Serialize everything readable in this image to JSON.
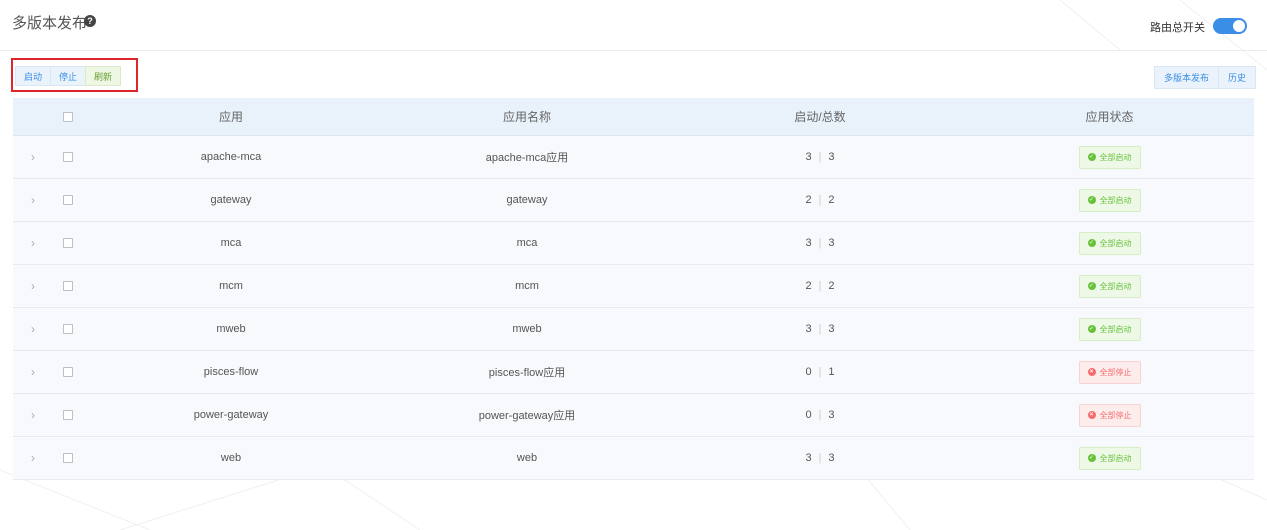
{
  "header": {
    "title": "多版本发布",
    "help_icon": "question-circle-icon",
    "route_switch_label": "路由总开关",
    "route_switch_on": true
  },
  "toolbar": {
    "start_label": "启动",
    "stop_label": "停止",
    "refresh_label": "刷新",
    "multi_release_label": "多版本发布",
    "history_label": "历史"
  },
  "table": {
    "columns": {
      "app": "应用",
      "name": "应用名称",
      "count": "启动/总数",
      "status": "应用状态"
    },
    "rows": [
      {
        "app": "apache-mca",
        "name": "apache-mca应用",
        "started": "3",
        "total": "3",
        "status": "全部启动",
        "state": "ok"
      },
      {
        "app": "gateway",
        "name": "gateway",
        "started": "2",
        "total": "2",
        "status": "全部启动",
        "state": "ok"
      },
      {
        "app": "mca",
        "name": "mca",
        "started": "3",
        "total": "3",
        "status": "全部启动",
        "state": "ok"
      },
      {
        "app": "mcm",
        "name": "mcm",
        "started": "2",
        "total": "2",
        "status": "全部启动",
        "state": "ok"
      },
      {
        "app": "mweb",
        "name": "mweb",
        "started": "3",
        "total": "3",
        "status": "全部启动",
        "state": "ok"
      },
      {
        "app": "pisces-flow",
        "name": "pisces-flow应用",
        "started": "0",
        "total": "1",
        "status": "全部停止",
        "state": "stop"
      },
      {
        "app": "power-gateway",
        "name": "power-gateway应用",
        "started": "0",
        "total": "3",
        "status": "全部停止",
        "state": "stop"
      },
      {
        "app": "web",
        "name": "web",
        "started": "3",
        "total": "3",
        "status": "全部启动",
        "state": "ok"
      }
    ]
  },
  "colors": {
    "accent": "#3a8ee6",
    "ok": "#67c23a",
    "stop": "#f56c6c",
    "highlight_box": "#e0252a"
  }
}
